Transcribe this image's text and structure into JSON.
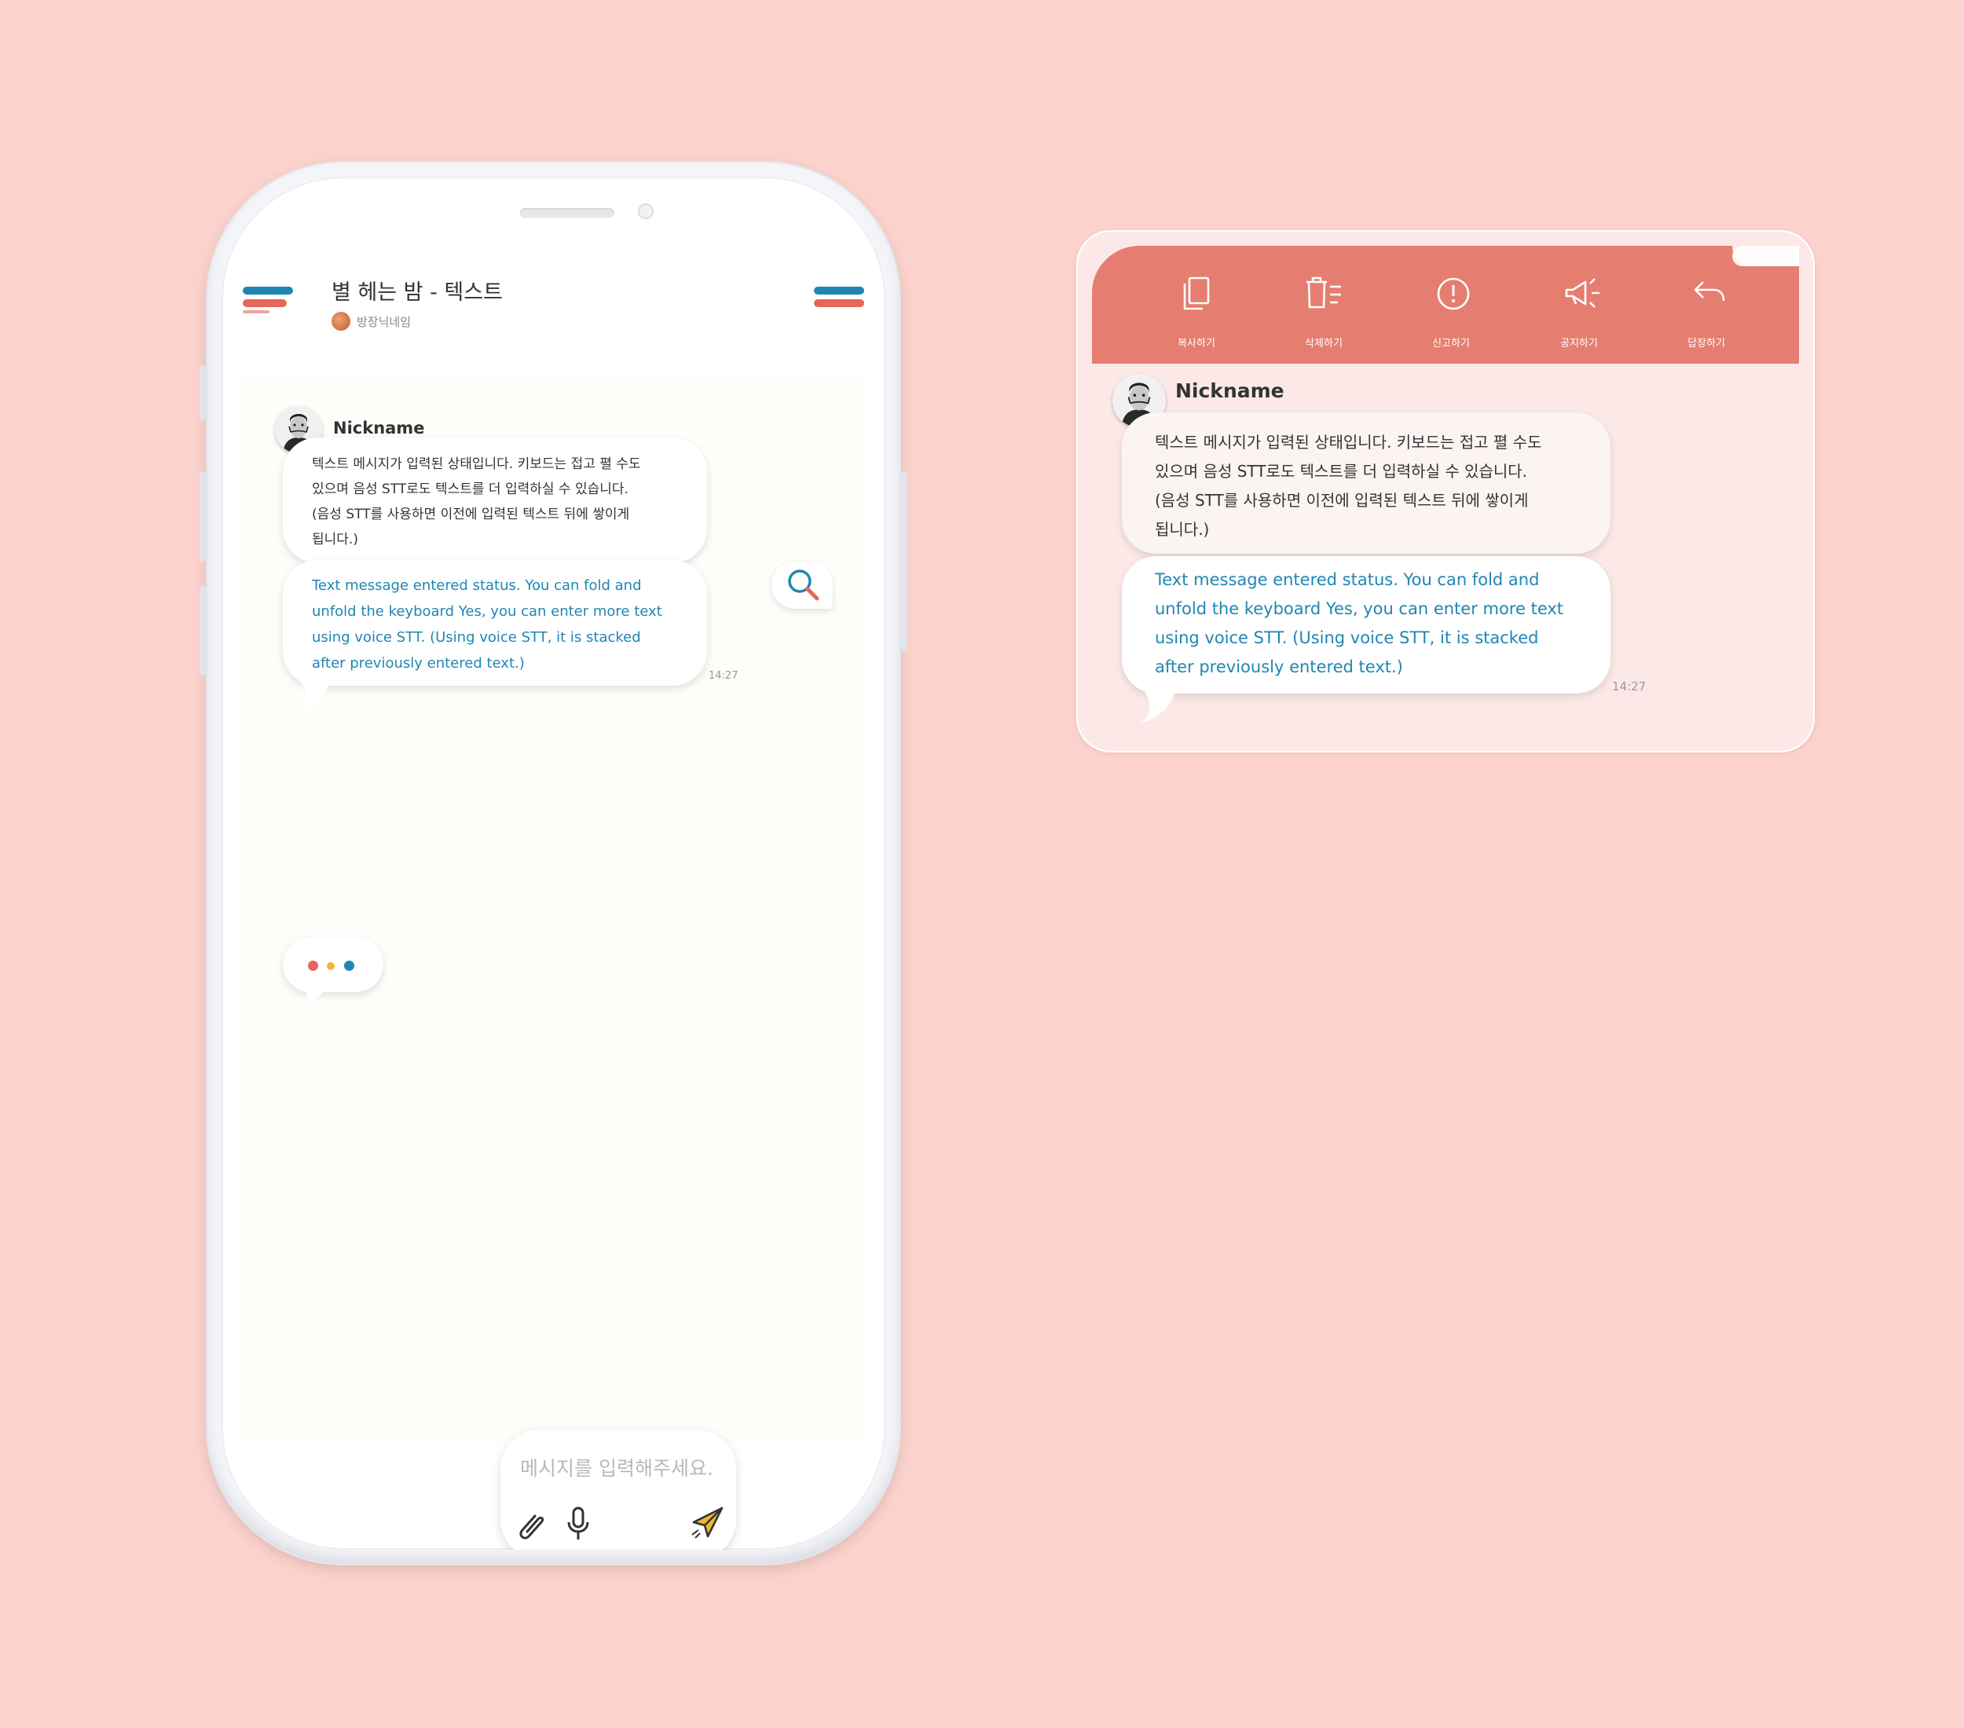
{
  "phone": {
    "room_title": "별 헤는 밤 - 텍스트",
    "host_name": "방장닉네임",
    "message": {
      "nickname": "Nickname",
      "text_kr": [
        "텍스트 메시지가 입력된 상태입니다. 키보드는 접고 펼 수도",
        "있으며 음성 STT로도 텍스트를 더 입력하실 수 있습니다.",
        "(음성 STT를 사용하면 이전에 입력된 텍스트 뒤에 쌓이게",
        "됩니다.)"
      ],
      "text_en": [
        "Text message entered status. You can fold and",
        "unfold the keyboard Yes, you can enter more text",
        "using voice STT. (Using voice STT, it is stacked",
        "after previously entered text.)"
      ],
      "time": "14:27"
    },
    "input_placeholder": "메시지를 입력해주세요.",
    "icons": [
      "menu-icon",
      "search-icon",
      "typing-indicator",
      "paperclip-icon",
      "microphone-icon",
      "send-icon"
    ]
  },
  "panel": {
    "tools": [
      {
        "label": "복사하기",
        "icon": "copy-icon"
      },
      {
        "label": "삭제하기",
        "icon": "delete-icon"
      },
      {
        "label": "신고하기",
        "icon": "report-icon"
      },
      {
        "label": "공지하기",
        "icon": "announce-icon"
      },
      {
        "label": "답장하기",
        "icon": "reply-icon"
      }
    ],
    "message": {
      "nickname": "Nickname",
      "text_kr": [
        "텍스트 메시지가 입력된 상태입니다. 키보드는 접고 펼 수도",
        "있으며 음성 STT로도 텍스트를 더 입력하실 수 있습니다.",
        "(음성 STT를 사용하면 이전에 입력된 텍스트 뒤에 쌓이게",
        "됩니다.)"
      ],
      "text_en": [
        "Text message entered status. You can fold and",
        "unfold the keyboard Yes, you can enter more text",
        "using voice STT. (Using voice STT, it is stacked",
        "after previously entered text.)"
      ],
      "time": "14:27"
    }
  },
  "colors": {
    "background": "#fbd2cc",
    "accent_blue": "#1f86b3",
    "accent_coral": "#e57e70",
    "typing_dots": [
      "#e5675a",
      "#f2b731",
      "#1f86b3"
    ],
    "send_icon": "#f2b731"
  }
}
